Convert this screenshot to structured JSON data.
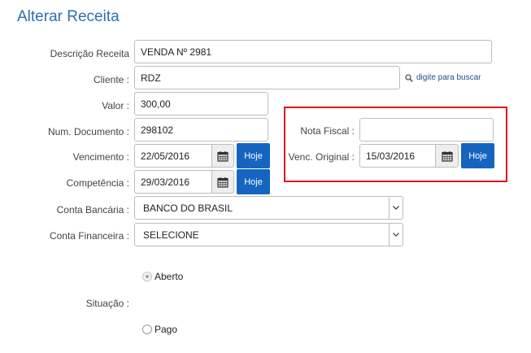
{
  "page": {
    "title": "Alterar Receita"
  },
  "form": {
    "descricao": {
      "label": "Descrição Receita",
      "value": "VENDA Nº 2981"
    },
    "cliente": {
      "label": "Cliente :",
      "value": "RDZ",
      "search_link": "digite para buscar"
    },
    "valor": {
      "label": "Valor :",
      "value": "300,00"
    },
    "num_documento": {
      "label": "Num. Documento :",
      "value": "298102"
    },
    "vencimento": {
      "label": "Vencimento :",
      "value": "22/05/2016",
      "hoje_label": "Hoje"
    },
    "competencia": {
      "label": "Competência :",
      "value": "29/03/2016",
      "hoje_label": "Hoje"
    },
    "nota_fiscal": {
      "label": "Nota Fiscal :",
      "value": ""
    },
    "venc_original": {
      "label": "Venc. Original :",
      "value": "15/03/2016",
      "hoje_label": "Hoje"
    },
    "conta_bancaria": {
      "label": "Conta Bancária :",
      "selected": "BANCO DO BRASIL"
    },
    "conta_financeira": {
      "label": "Conta Financeira :",
      "selected": "SELECIONE"
    },
    "situacao": {
      "label": "Situação :",
      "options": [
        {
          "label": "Aberto",
          "checked": true,
          "disabled": true
        },
        {
          "label": "Pago",
          "checked": false
        }
      ]
    }
  },
  "icons": {
    "calendar": "calendar-icon",
    "search": "magnifier-icon",
    "dropdown": "chevron-down-icon"
  },
  "colors": {
    "title": "#2f6fae",
    "button": "#1565c0",
    "highlight": "#e0141e"
  }
}
